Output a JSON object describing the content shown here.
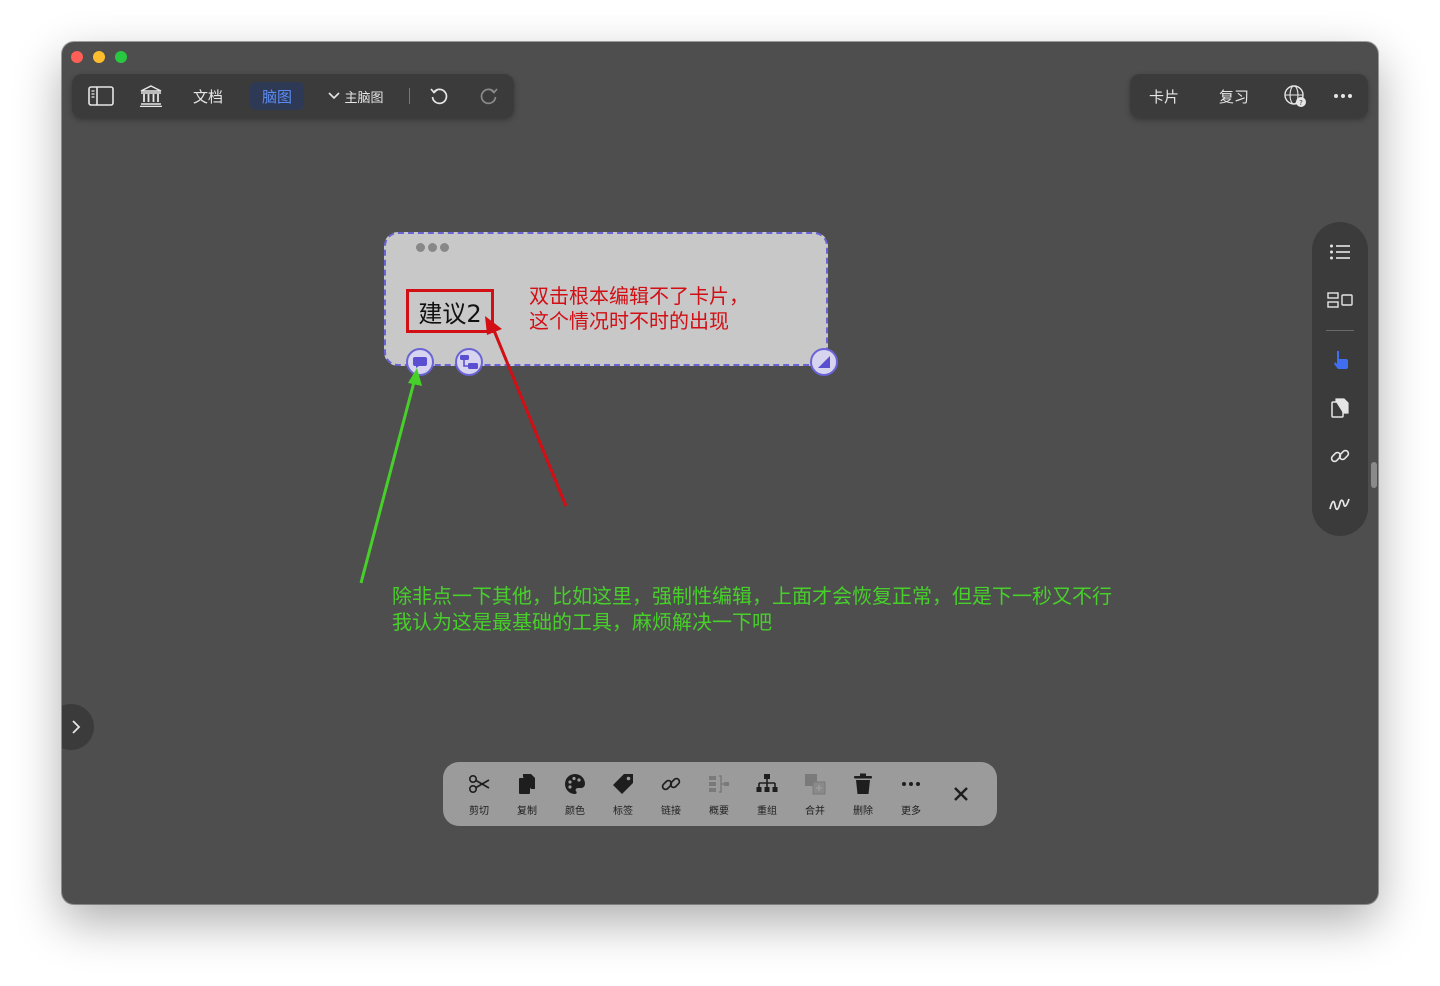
{
  "toolbar_left": {
    "doc_label": "文档",
    "mindmap_label": "脑图",
    "main_mindmap_label": "主脑图"
  },
  "toolbar_right": {
    "cards_label": "卡片",
    "review_label": "复习"
  },
  "card": {
    "title": "建议2"
  },
  "annotations": {
    "red_line1": "双击根本编辑不了卡片，",
    "red_line2": "这个情况时不时的出现",
    "green_line1": "除非点一下其他，比如这里，强制性编辑，上面才会恢复正常，但是下一秒又不行",
    "green_line2": "我认为这是最基础的工具，麻烦解决一下吧"
  },
  "bottom_toolbar": {
    "items": [
      {
        "label": "剪切",
        "icon": "scissors-icon"
      },
      {
        "label": "复制",
        "icon": "copy-icon"
      },
      {
        "label": "颜色",
        "icon": "palette-icon"
      },
      {
        "label": "标签",
        "icon": "tag-icon"
      },
      {
        "label": "链接",
        "icon": "link-icon"
      },
      {
        "label": "概要",
        "icon": "summary-icon"
      },
      {
        "label": "重组",
        "icon": "reorganize-icon"
      },
      {
        "label": "合并",
        "icon": "merge-icon"
      },
      {
        "label": "删除",
        "icon": "trash-icon"
      },
      {
        "label": "更多",
        "icon": "more-icon"
      }
    ]
  },
  "colors": {
    "window_bg": "#4e4e4e",
    "panel_bg": "#3b3b3b",
    "accent_blue": "#5b8bf2",
    "annotation_red": "#d10f15",
    "annotation_green": "#47d02a",
    "card_border": "#6a63d6"
  }
}
